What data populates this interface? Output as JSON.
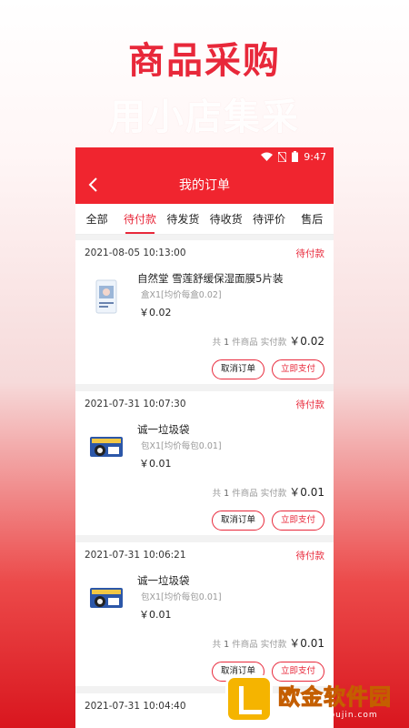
{
  "promo": {
    "title": "商品采购",
    "subtitle": "用小店集采"
  },
  "status_bar": {
    "time": "9:47"
  },
  "nav": {
    "title": "我的订单"
  },
  "tabs": [
    {
      "label": "全部"
    },
    {
      "label": "待付款",
      "active": true
    },
    {
      "label": "待发货"
    },
    {
      "label": "待收货"
    },
    {
      "label": "待评价"
    },
    {
      "label": "售后"
    }
  ],
  "orders": [
    {
      "time": "2021-08-05 10:13:00",
      "status": "待付款",
      "item_name": "自然堂 雪莲舒缓保湿面膜5片装",
      "spec": "盒X1[均价每盒0.02]",
      "price": "￥0.02",
      "summary_prefix": "共",
      "count": "1",
      "summary_mid": "件商品 实付款",
      "total": "￥0.02",
      "cancel": "取消订单",
      "pay": "立即支付"
    },
    {
      "time": "2021-07-31 10:07:30",
      "status": "待付款",
      "item_name": "诚一垃圾袋",
      "spec": "包X1[均价每包0.01]",
      "price": "￥0.01",
      "summary_prefix": "共",
      "count": "1",
      "summary_mid": "件商品 实付款",
      "total": "￥0.01",
      "cancel": "取消订单",
      "pay": "立即支付"
    },
    {
      "time": "2021-07-31 10:06:21",
      "status": "待付款",
      "item_name": "诚一垃圾袋",
      "spec": "包X1[均价每包0.01]",
      "price": "￥0.01",
      "summary_prefix": "共",
      "count": "1",
      "summary_mid": "件商品 实付款",
      "total": "￥0.01",
      "cancel": "取消订单",
      "pay": "立即支付"
    },
    {
      "time": "2021-07-31 10:04:40"
    }
  ],
  "watermark": {
    "text": "欧金软件园",
    "url": "www.apoujin.com"
  },
  "colors": {
    "accent": "#e8283a",
    "bar": "#f0252f",
    "watermark": "#f5b400"
  }
}
